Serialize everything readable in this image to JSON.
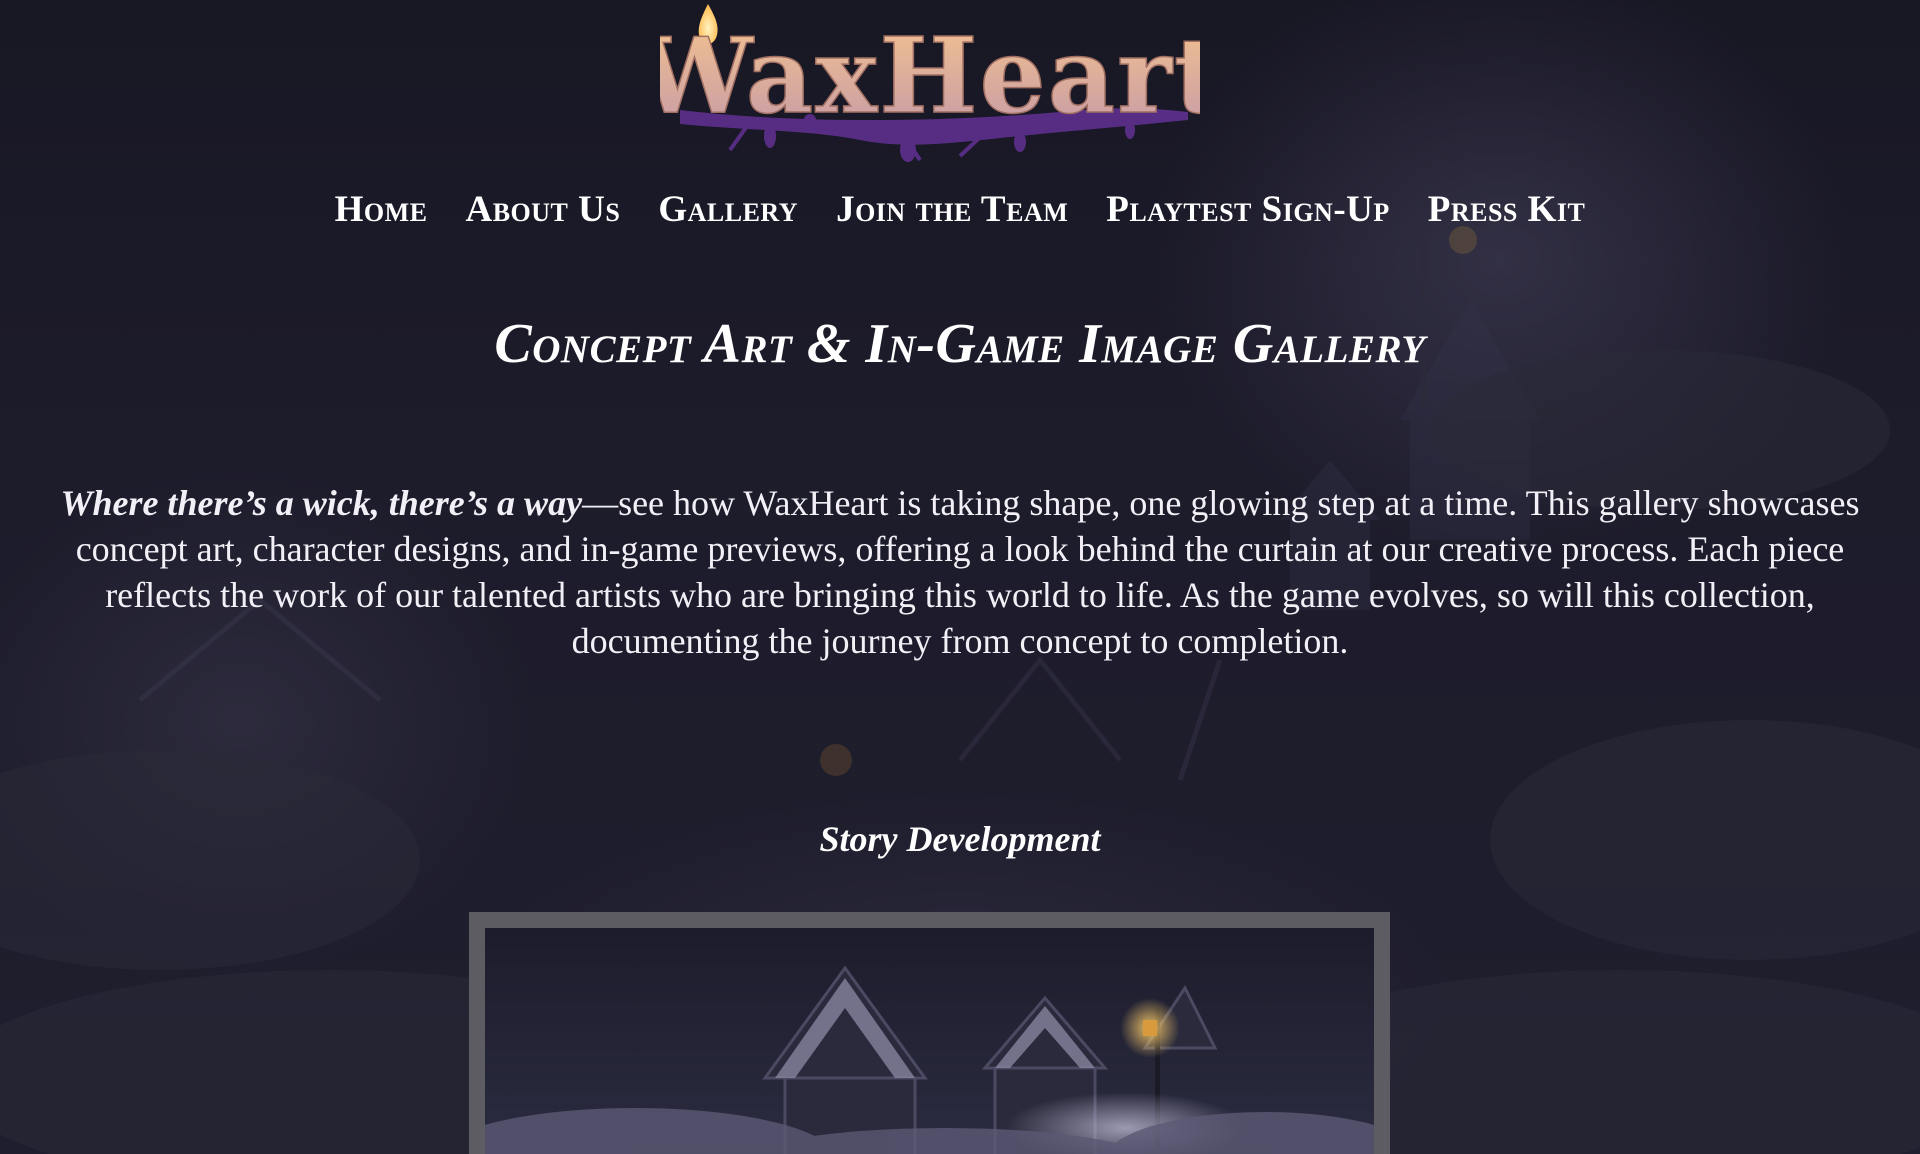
{
  "site": {
    "logo_text": "WaxHeart"
  },
  "nav": {
    "items": [
      {
        "label": "Home"
      },
      {
        "label": "About Us"
      },
      {
        "label": "Gallery"
      },
      {
        "label": "Join the Team"
      },
      {
        "label": "Playtest Sign-Up"
      },
      {
        "label": "Press Kit"
      }
    ]
  },
  "page": {
    "title": "Concept Art & In-Game Image Gallery",
    "intro_emphasis": "Where there’s a wick, there’s a way",
    "intro_text": "—see how WaxHeart is taking shape, one glowing step at a time. This gallery showcases concept art, character designs, and in-game previews, offering a look behind the curtain at our creative process. Each piece reflects the work of our talented artists who are bringing this world to life. As the game evolves, so will this collection, documenting the journey from concept to completion."
  },
  "gallery": {
    "sections": [
      {
        "title": "Story Development"
      }
    ]
  },
  "colors": {
    "background": "#1a1a28",
    "text": "#ffffff",
    "logo_gradient_top": "#f4c38e",
    "logo_gradient_bottom": "#c59aa8",
    "logo_drip": "#5b2f8a",
    "frame_border": "#5d5c63",
    "candle_flame": "#ffd36b"
  }
}
